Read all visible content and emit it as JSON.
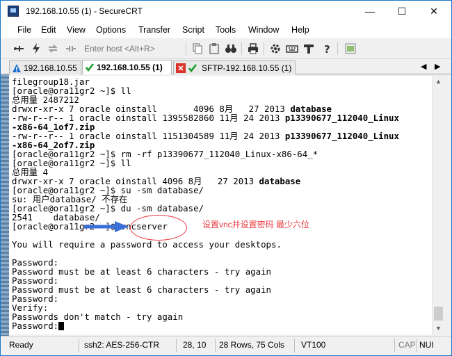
{
  "window": {
    "title": "192.168.10.55 (1) - SecureCRT",
    "controls": {
      "minimize": "—",
      "maximize": "☐",
      "close": "✕"
    }
  },
  "menu": [
    "File",
    "Edit",
    "View",
    "Options",
    "Transfer",
    "Script",
    "Tools",
    "Window",
    "Help"
  ],
  "toolbar": {
    "host_placeholder": "Enter host <Alt+R>",
    "icons": [
      "connect-icon",
      "quick-connect-icon",
      "reconnect-icon",
      "disconnect-icon",
      "copy-icon",
      "paste-icon",
      "find-icon",
      "print-icon",
      "settings-icon",
      "keymap-icon",
      "sftp-icon",
      "help-icon",
      "script-icon"
    ]
  },
  "tabs": [
    {
      "label": "192.168.10.55",
      "status": "warning"
    },
    {
      "label": "192.168.10.55 (1)",
      "status": "connected",
      "active": true
    },
    {
      "label": "SFTP-192.168.10.55 (1)",
      "status": "connected"
    }
  ],
  "terminal": {
    "lines": [
      {
        "t": "filegroup18.jar"
      },
      {
        "t": "[oracle@ora11gr2 ~]$ ll"
      },
      {
        "t": "总用量 2487212"
      },
      {
        "t": "drwxr-xr-x 7 oracle oinstall       4096 8月   27 2013 ",
        "b": "database"
      },
      {
        "t": "-rw-r--r-- 1 oracle oinstall 1395582860 11月 24 2013 ",
        "b": "p13390677_112040_Linux"
      },
      {
        "t": "",
        "b": "-x86-64_1of7.zip"
      },
      {
        "t": "-rw-r--r-- 1 oracle oinstall 1151304589 11月 24 2013 ",
        "b": "p13390677_112040_Linux"
      },
      {
        "t": "",
        "b": "-x86-64_2of7.zip"
      },
      {
        "t": "[oracle@ora11gr2 ~]$ rm -rf p13390677_112040_Linux-x86-64_*"
      },
      {
        "t": "[oracle@ora11gr2 ~]$ ll"
      },
      {
        "t": "总用量 4"
      },
      {
        "t": "drwxr-xr-x 7 oracle oinstall 4096 8月   27 2013 ",
        "b": "database"
      },
      {
        "t": "[oracle@ora11gr2 ~]$ su -sm database/"
      },
      {
        "t": "su: 用户database/ 不存在"
      },
      {
        "t": "[oracle@ora11gr2 ~]$ du -sm database/"
      },
      {
        "t": "2541    database/"
      },
      {
        "t": "[oracle@ora11gr2 ~]$ vncserver"
      },
      {
        "t": ""
      },
      {
        "t": "You will require a password to access your desktops."
      },
      {
        "t": ""
      },
      {
        "t": "Password:"
      },
      {
        "t": "Password must be at least 6 characters - try again"
      },
      {
        "t": "Password:"
      },
      {
        "t": "Password must be at least 6 characters - try again"
      },
      {
        "t": "Password:"
      },
      {
        "t": "Verify:"
      },
      {
        "t": "Passwords don't match - try again"
      },
      {
        "t": "Password:",
        "cursor": true
      }
    ]
  },
  "annotation": {
    "text": "设置vnc并设置密码  最少六位",
    "color": "#e8383d",
    "arrow_color": "#3a6fd8"
  },
  "statusbar": {
    "ready": "Ready",
    "cipher": "ssh2: AES-256-CTR",
    "cursor_pos": "28, 10",
    "size": "28 Rows, 75 Cols",
    "terminal_type": "VT100",
    "cap": "CAP",
    "num": "NUI"
  }
}
